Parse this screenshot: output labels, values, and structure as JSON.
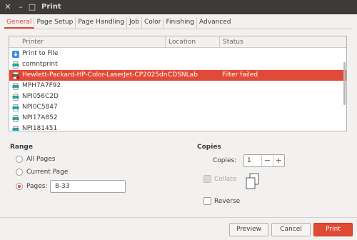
{
  "window": {
    "title": "Print"
  },
  "tabs": [
    "General",
    "Page Setup",
    "Page Handling",
    "Job",
    "Color",
    "Finishing",
    "Advanced"
  ],
  "table": {
    "headers": [
      "Printer",
      "Location",
      "Status"
    ],
    "rows": [
      {
        "name": "Print to File",
        "location": "",
        "status": "",
        "icon": "download-icon"
      },
      {
        "name": "comntprint",
        "location": "",
        "status": "",
        "icon": "printer-icon"
      },
      {
        "name": "Hewlett-Packard-HP-Color-LaserJet-CP2025dn",
        "location": "CDSNLab",
        "status": "Filter failed",
        "icon": "printer-error-icon",
        "selected": true
      },
      {
        "name": "MPH7A7F92",
        "location": "",
        "status": "",
        "icon": "printer-icon"
      },
      {
        "name": "NPI056C2D",
        "location": "",
        "status": "",
        "icon": "printer-icon"
      },
      {
        "name": "NPI0C5847",
        "location": "",
        "status": "",
        "icon": "printer-icon"
      },
      {
        "name": "NPI17A852",
        "location": "",
        "status": "",
        "icon": "printer-icon"
      },
      {
        "name": "NPI181451",
        "location": "",
        "status": "",
        "icon": "printer-icon"
      }
    ]
  },
  "range": {
    "heading": "Range",
    "all_pages": "All Pages",
    "current_page": "Current Page",
    "pages_label": "Pages:",
    "pages_value": "8-33"
  },
  "copies": {
    "heading": "Copies",
    "copies_label": "Copies:",
    "copies_value": "1",
    "collate_label": "Collate",
    "reverse_label": "Reverse"
  },
  "buttons": {
    "preview": "Preview",
    "cancel": "Cancel",
    "print": "Print"
  },
  "colors": {
    "accent": "#e24a38",
    "titlebar": "#3c3b37"
  }
}
